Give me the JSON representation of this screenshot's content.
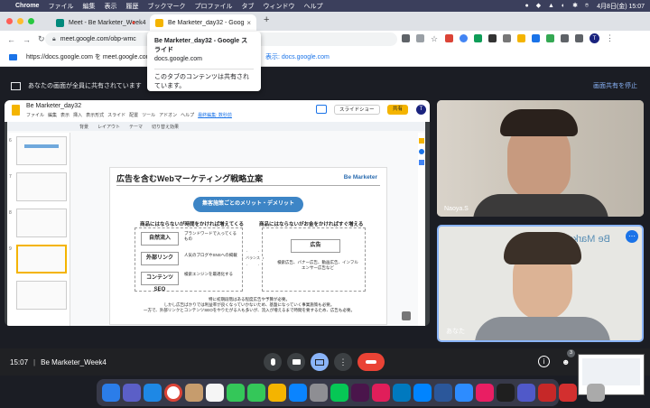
{
  "menubar": {
    "app": "Chrome",
    "items": [
      "ファイル",
      "編集",
      "表示",
      "履歴",
      "ブックマーク",
      "プロファイル",
      "タブ",
      "ウィンドウ",
      "ヘルプ"
    ],
    "clock": "4月8日(金) 15:07"
  },
  "tabs": [
    {
      "title": "Meet - Be Marketer_Week4"
    },
    {
      "title": "Be Marketer_day32 - Goog"
    }
  ],
  "toolbar": {
    "url": "meet.google.com/obp-wmc"
  },
  "tooltip": {
    "title": "Be Marketer_day32 - Google スライド",
    "domain": "docs.google.com",
    "note": "このタブのコンテンツは共有されています。"
  },
  "infobar": {
    "text": "https://docs.google.com を meet.google.com",
    "link": "表示: docs.google.com"
  },
  "sharebar": {
    "text": "あなたの画面が全員に共有されています",
    "stop": "画面共有を停止"
  },
  "docs": {
    "title": "Be Marketer_day32",
    "menu": [
      "ファイル",
      "編集",
      "表示",
      "挿入",
      "表示形式",
      "スライド",
      "配置",
      "ツール",
      "アドオン",
      "ヘルプ",
      "最終編集: 数秒前"
    ],
    "slideshow": "スライドショー",
    "share": "共有",
    "tools": [
      "背景",
      "レイアウト",
      "テーマ",
      "切り替え効果"
    ],
    "thumbnails": [
      "6",
      "7",
      "8",
      "9"
    ]
  },
  "slide": {
    "title": "広告を含むWebマーケティング戦略立案",
    "brand": "Be Marketer",
    "pill": "集客施策ごとのメリット・デメリット",
    "left_head": "商品にはならないが時間をかければ増えてくる",
    "right_head": "商品にはならないがお金をかければすぐ増える",
    "items": [
      {
        "label": "自然流入",
        "desc": "ブランドワードで入ってくるもの"
      },
      {
        "label": "外部リンク",
        "desc": "人気のブログやSNSへの掲載"
      },
      {
        "label": "コンテンツSEO",
        "desc": "検索エンジンを最適化する"
      }
    ],
    "balance": "バランス",
    "ad": "広告",
    "ad_desc": "検索広告、バナー広告、動画広告、インフルエンサー広告など",
    "foot1": "特に初期段階はある程度広告や予算が必要。",
    "foot2": "しかし広告ばかりでは利益率が良くなっていかないため、基盤になっていく事業施策も必要。",
    "foot3": "一方で、外部リンクとコンテンツSEOをやりたがる人も多いが、流入が増えるまで時間を要するため、広告も必要。"
  },
  "participants": [
    {
      "name": "Naoya.S"
    },
    {
      "name": "あなた"
    }
  ],
  "meeting": {
    "time": "15:07",
    "separator": "|",
    "name": "Be Marketer_Week4",
    "people_count": "3"
  },
  "colors": {
    "accent": "#1a73e8",
    "end_call": "#ea4335",
    "meet_bg": "#202124"
  }
}
